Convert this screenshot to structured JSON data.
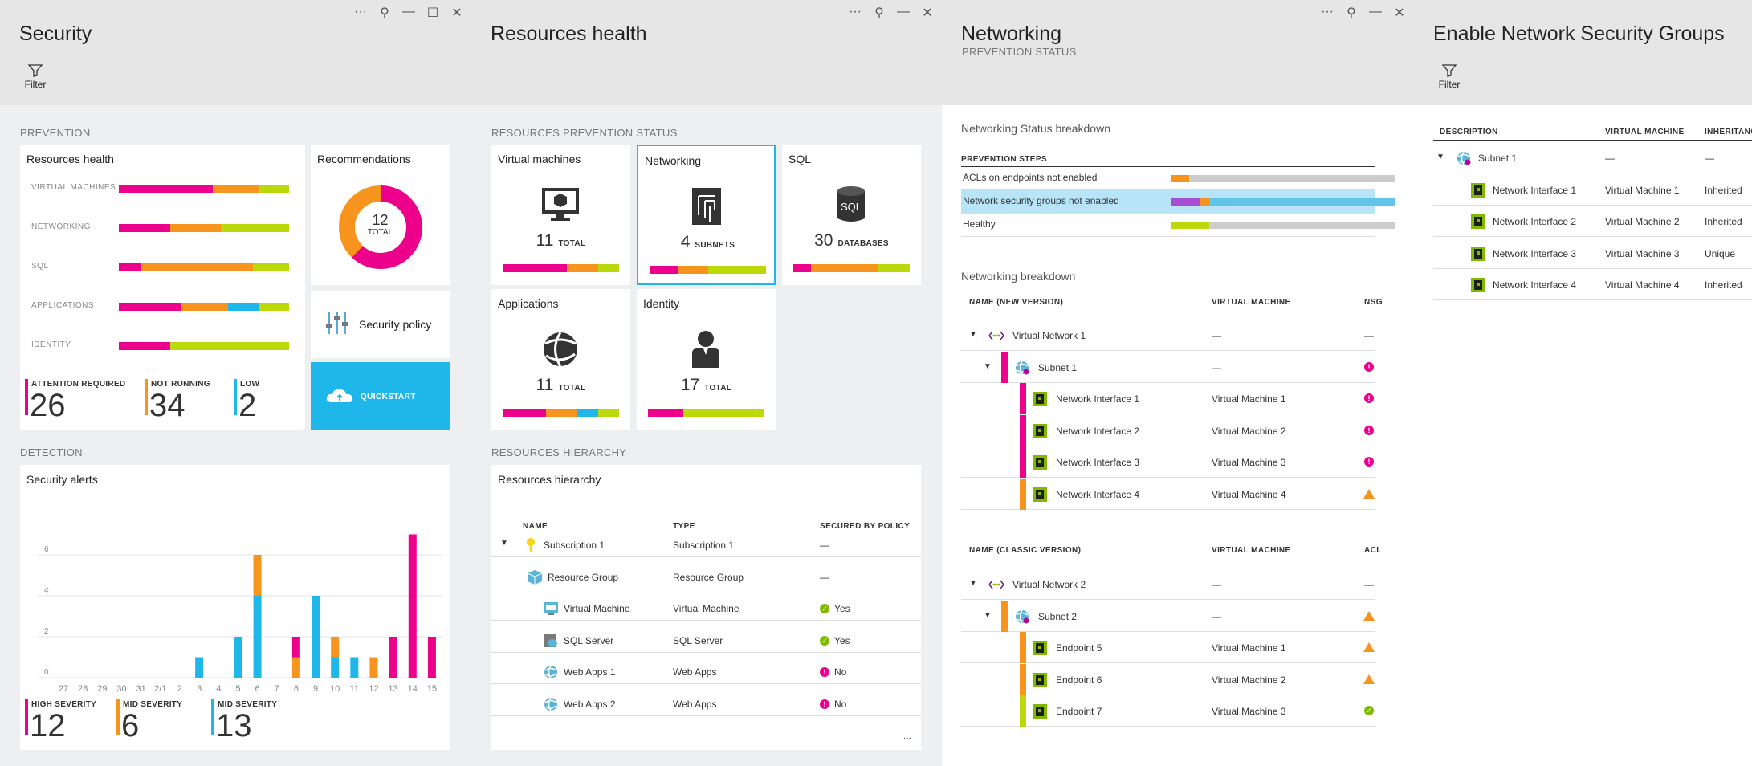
{
  "blades": {
    "security": {
      "title": "Security",
      "filter_label": "Filter",
      "prevention_label": "PREVENTION",
      "detection_label": "DETECTION",
      "resources_health": {
        "title": "Resources health",
        "rows": [
          {
            "label": "VIRTUAL MACHINES",
            "segments": [
              {
                "color": "#ec008c",
                "pct": 55
              },
              {
                "color": "#f7941d",
                "pct": 27
              },
              {
                "color": "#bad80a",
                "pct": 18
              }
            ]
          },
          {
            "label": "NETWORKING",
            "segments": [
              {
                "color": "#ec008c",
                "pct": 30
              },
              {
                "color": "#f7941d",
                "pct": 30
              },
              {
                "color": "#bad80a",
                "pct": 40
              }
            ]
          },
          {
            "label": "SQL",
            "segments": [
              {
                "color": "#ec008c",
                "pct": 13
              },
              {
                "color": "#f7941d",
                "pct": 66
              },
              {
                "color": "#bad80a",
                "pct": 21
              }
            ]
          },
          {
            "label": "APPLICATIONS",
            "segments": [
              {
                "color": "#ec008c",
                "pct": 37
              },
              {
                "color": "#f7941d",
                "pct": 27
              },
              {
                "color": "#1fb7ea",
                "pct": 18
              },
              {
                "color": "#bad80a",
                "pct": 18
              }
            ]
          },
          {
            "label": "IDENTITY",
            "segments": [
              {
                "color": "#ec008c",
                "pct": 30
              },
              {
                "color": "#bad80a",
                "pct": 70
              }
            ]
          }
        ],
        "stats": [
          {
            "label": "ATTENTION REQUIRED",
            "value": "26",
            "color": "#ec008c"
          },
          {
            "label": "NOT RUNNING",
            "value": "34",
            "color": "#f7941d"
          },
          {
            "label": "LOW",
            "value": "2",
            "color": "#1fb7ea"
          }
        ]
      },
      "recommendations": {
        "title": "Recommendations",
        "count": "12",
        "count_label": "TOTAL",
        "pink_fraction": 0.62
      },
      "security_policy": {
        "label": "Security policy"
      },
      "quickstart": {
        "label": "QUICKSTART"
      },
      "alerts": {
        "title": "Security alerts",
        "stats": [
          {
            "label": "HIGH SEVERITY",
            "value": "12",
            "color": "#ec008c"
          },
          {
            "label": "MID SEVERITY",
            "value": "6",
            "color": "#f7941d"
          },
          {
            "label": "MID SEVERITY",
            "value": "13",
            "color": "#1fb7ea"
          }
        ]
      }
    },
    "resources": {
      "title": "Resources health",
      "prevention_label": "RESOURCES PREVENTION STATUS",
      "hierarchy_label": "RESOURCES HIERARCHY",
      "tiles": [
        {
          "title": "Virtual machines",
          "value": "11",
          "unit": "TOTAL",
          "icon": "monitor-icon",
          "segments": [
            {
              "color": "#ec008c",
              "pct": 55
            },
            {
              "color": "#f7941d",
              "pct": 27
            },
            {
              "color": "#bad80a",
              "pct": 18
            }
          ]
        },
        {
          "title": "Networking",
          "value": "4",
          "unit": "SUBNETS",
          "icon": "network-icon",
          "selected": true,
          "segments": [
            {
              "color": "#ec008c",
              "pct": 25
            },
            {
              "color": "#f7941d",
              "pct": 25
            },
            {
              "color": "#bad80a",
              "pct": 50
            }
          ]
        },
        {
          "title": "SQL",
          "value": "30",
          "unit": "DATABASES",
          "icon": "sql-icon",
          "segments": [
            {
              "color": "#ec008c",
              "pct": 15
            },
            {
              "color": "#f7941d",
              "pct": 58
            },
            {
              "color": "#bad80a",
              "pct": 27
            }
          ]
        },
        {
          "title": "Applications",
          "value": "11",
          "unit": "TOTAL",
          "icon": "globe-icon",
          "segments": [
            {
              "color": "#ec008c",
              "pct": 37
            },
            {
              "color": "#f7941d",
              "pct": 27
            },
            {
              "color": "#1fb7ea",
              "pct": 18
            },
            {
              "color": "#bad80a",
              "pct": 18
            }
          ]
        },
        {
          "title": "Identity",
          "value": "17",
          "unit": "TOTAL",
          "icon": "person-icon",
          "segments": [
            {
              "color": "#ec008c",
              "pct": 30
            },
            {
              "color": "#bad80a",
              "pct": 70
            }
          ]
        }
      ],
      "hierarchy": {
        "title": "Resources hierarchy",
        "columns": [
          "NAME",
          "TYPE",
          "SECURED BY POLICY"
        ],
        "rows": [
          {
            "name": "Subscription 1",
            "type": "Subscription 1",
            "secured": "—",
            "icon": "key-icon",
            "status": "none"
          },
          {
            "name": "Resource Group",
            "type": "Resource Group",
            "secured": "—",
            "icon": "cube-icon",
            "status": "none"
          },
          {
            "name": "Virtual Machine",
            "type": "Virtual Machine",
            "secured": "Yes",
            "icon": "vm-icon",
            "status": "ok"
          },
          {
            "name": "SQL Server",
            "type": "SQL Server",
            "secured": "Yes",
            "icon": "sql-server-icon",
            "status": "ok"
          },
          {
            "name": "Web Apps 1",
            "type": "Web Apps",
            "secured": "No",
            "icon": "webapp-icon",
            "status": "bad"
          },
          {
            "name": "Web Apps 2",
            "type": "Web Apps",
            "secured": "No",
            "icon": "webapp-icon",
            "status": "bad"
          }
        ],
        "more": "..."
      }
    },
    "networking": {
      "title": "Networking",
      "subtitle": "PREVENTION STATUS",
      "status_breakdown_title": "Networking Status breakdown",
      "steps_header": "PREVENTION STEPS",
      "steps": [
        {
          "label": "ACLs on endpoints not enabled",
          "segments": [
            {
              "color": "#f7941d",
              "pct": 8
            },
            {
              "color": "#ccc",
              "pct": 92
            }
          ]
        },
        {
          "label": "Network security groups not enabled",
          "selected": true,
          "segments": [
            {
              "color": "#a84ed3",
              "pct": 13
            },
            {
              "color": "#f7941d",
              "pct": 4
            },
            {
              "color": "#62c4e8",
              "pct": 83
            }
          ]
        },
        {
          "label": "Healthy",
          "segments": [
            {
              "color": "#bad80a",
              "pct": 17
            },
            {
              "color": "#ccc",
              "pct": 83
            }
          ]
        }
      ],
      "breakdown_title": "Networking breakdown",
      "new_columns": [
        "NAME (NEW VERSION)",
        "VIRTUAL MACHINE",
        "NSG"
      ],
      "new_rows": [
        {
          "name": "Virtual Network 1",
          "vm": "—",
          "status": "none",
          "level": 0,
          "icon": "vnet-icon",
          "stripe": ""
        },
        {
          "name": "Subnet 1",
          "vm": "—",
          "status": "bad",
          "level": 1,
          "icon": "subnet-icon",
          "stripe": "#ec008c"
        },
        {
          "name": "Network Interface 1",
          "vm": "Virtual Machine 1",
          "status": "bad",
          "level": 2,
          "icon": "nic-icon",
          "stripe": "#ec008c"
        },
        {
          "name": "Network Interface 2",
          "vm": "Virtual Machine 2",
          "status": "bad",
          "level": 2,
          "icon": "nic-icon",
          "stripe": "#ec008c"
        },
        {
          "name": "Network Interface 3",
          "vm": "Virtual Machine 3",
          "status": "bad",
          "level": 2,
          "icon": "nic-icon",
          "stripe": "#ec008c"
        },
        {
          "name": "Network Interface 4",
          "vm": "Virtual Machine 4",
          "status": "warn",
          "level": 2,
          "icon": "nic-icon",
          "stripe": "#f7941d"
        }
      ],
      "classic_columns": [
        "NAME (CLASSIC VERSION)",
        "VIRTUAL MACHINE",
        "ACL"
      ],
      "classic_rows": [
        {
          "name": "Virtual Network 2",
          "vm": "—",
          "status": "none",
          "level": 0,
          "icon": "vnet-icon",
          "stripe": ""
        },
        {
          "name": "Subnet 2",
          "vm": "—",
          "status": "warn",
          "level": 1,
          "icon": "subnet-icon",
          "stripe": "#f7941d"
        },
        {
          "name": "Endpoint 5",
          "vm": "Virtual Machine 1",
          "status": "warn",
          "level": 2,
          "icon": "nic-icon",
          "stripe": "#f7941d"
        },
        {
          "name": "Endpoint  6",
          "vm": "Virtual Machine 2",
          "status": "warn",
          "level": 2,
          "icon": "nic-icon",
          "stripe": "#f7941d"
        },
        {
          "name": "Endpoint  7",
          "vm": "Virtual Machine 3",
          "status": "ok",
          "level": 2,
          "icon": "nic-icon",
          "stripe": "#bad80a"
        }
      ]
    },
    "nsg": {
      "title": "Enable Network Security Groups",
      "filter_label": "Filter",
      "columns": [
        "DESCRIPTION",
        "VIRTUAL MACHINE",
        "INHERITANCE"
      ],
      "rows": [
        {
          "name": "Subnet 1",
          "vm": "—",
          "inheritance": "—",
          "level": 0,
          "icon": "subnet-icon"
        },
        {
          "name": "Network Interface 1",
          "vm": "Virtual Machine 1",
          "inheritance": "Inherited",
          "level": 1,
          "icon": "nic-icon"
        },
        {
          "name": "Network Interface 2",
          "vm": "Virtual Machine 2",
          "inheritance": "Inherited",
          "level": 1,
          "icon": "nic-icon"
        },
        {
          "name": "Network Interface 3",
          "vm": "Virtual Machine 3",
          "inheritance": "Unique",
          "level": 1,
          "icon": "nic-icon"
        },
        {
          "name": "Network Interface 4",
          "vm": "Virtual Machine 4",
          "inheritance": "Inherited",
          "level": 1,
          "icon": "nic-icon"
        }
      ]
    }
  },
  "controls": {
    "more": "···",
    "pin": "⚲",
    "minimize": "—",
    "maximize": "☐",
    "close": "✕"
  },
  "chart_data": {
    "type": "bar",
    "title": "Security alerts",
    "categories": [
      "27",
      "28",
      "29",
      "30",
      "31",
      "2/1",
      "2",
      "3",
      "4",
      "5",
      "6",
      "7",
      "8",
      "9",
      "10",
      "11",
      "12",
      "13",
      "14",
      "15"
    ],
    "series": [
      {
        "name": "HIGH SEVERITY",
        "color": "#ec008c",
        "values": [
          0,
          0,
          0,
          0,
          0,
          0,
          0,
          0,
          0,
          0,
          0,
          0,
          1,
          0,
          0,
          0,
          0,
          2,
          7,
          2
        ]
      },
      {
        "name": "MID SEVERITY",
        "color": "#f7941d",
        "values": [
          0,
          0,
          0,
          0,
          0,
          0,
          0,
          0,
          0,
          0,
          2,
          0,
          1,
          0,
          1,
          0,
          1,
          0,
          0,
          0
        ]
      },
      {
        "name": "MID SEVERITY",
        "color": "#1fb7ea",
        "values": [
          0,
          0,
          0,
          0,
          0,
          0,
          0,
          1,
          0,
          2,
          4,
          0,
          0,
          4,
          1,
          1,
          0,
          0,
          0,
          0
        ]
      }
    ],
    "stacked": true,
    "yticks": [
      "0",
      "2",
      "4",
      "6"
    ],
    "ylim": [
      0,
      8
    ],
    "grid": true
  }
}
